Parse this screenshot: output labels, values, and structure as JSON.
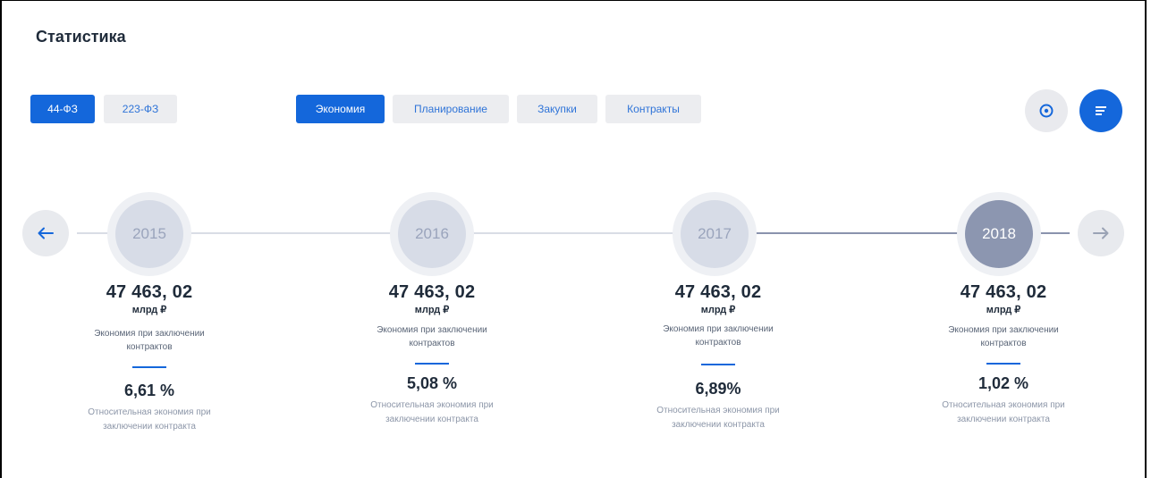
{
  "header": {
    "title": "Статистика"
  },
  "law_tabs": [
    {
      "label": "44-ФЗ",
      "active": true
    },
    {
      "label": "223-ФЗ",
      "active": false
    }
  ],
  "section_tabs": [
    {
      "label": "Экономия",
      "active": true
    },
    {
      "label": "Планирование",
      "active": false
    },
    {
      "label": "Закупки",
      "active": false
    },
    {
      "label": "Контракты",
      "active": false
    }
  ],
  "toolbar": {
    "location_icon": "location-pin-icon",
    "filter_icon": "filter-lines-icon"
  },
  "nav": {
    "prev_icon": "arrow-left-icon",
    "next_icon": "arrow-right-icon"
  },
  "timeline": [
    {
      "year": "2015",
      "selected": false,
      "amount": "47 463, 02",
      "unit": "млрд ₽",
      "description": "Экономия при заключении контрактов",
      "percent": "6,61 %",
      "percent_description": "Относительная экономия при заключении контракта"
    },
    {
      "year": "2016",
      "selected": false,
      "amount": "47 463, 02",
      "unit": "млрд ₽",
      "description": "Экономия при заключении контрактов",
      "percent": "5,08 %",
      "percent_description": "Относительная экономия при заключении контракта"
    },
    {
      "year": "2017",
      "selected": false,
      "amount": "47 463, 02",
      "unit": "млрд ₽",
      "description": "Экономия при заключении контрактов",
      "percent": "6,89%",
      "percent_description": "Относительная экономия при заключении контракта"
    },
    {
      "year": "2018",
      "selected": true,
      "amount": "47 463, 02",
      "unit": "млрд ₽",
      "description": "Экономия при заключении контрактов",
      "percent": "1,02 %",
      "percent_description": "Относительная экономия при заключении контракта"
    }
  ],
  "colors": {
    "accent": "#1467db",
    "timeline_active": "#8a93ad",
    "timeline_inactive": "#d9dde5"
  }
}
